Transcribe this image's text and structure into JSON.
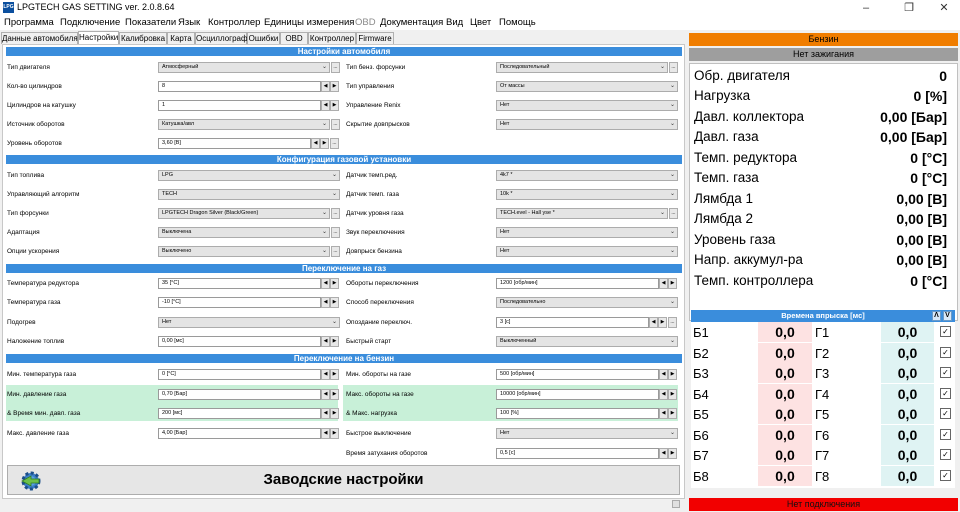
{
  "window": {
    "title": "LPGTECH GAS SETTING ver. 2.0.8.64",
    "icon_text": "LPG",
    "controls": [
      "minimize-icon",
      "restore-icon",
      "close-icon"
    ]
  },
  "menu": [
    "Программа",
    "Подключение",
    "Показатели",
    "Язык",
    "Контроллер",
    "Единицы измерения",
    "OBD",
    "Документация",
    "Вид",
    "Цвет",
    "Помощь"
  ],
  "tabs": [
    "Данные автомобиля",
    "Настройки",
    "Калибровка",
    "Карта",
    "Осциллограф",
    "Ошибки",
    "OBD",
    "Контроллер",
    "Firmware"
  ],
  "active_tab": 1,
  "sections": {
    "car": "Настройки автомобиля",
    "gas": "Конфигурация газовой установки",
    "to_gas": "Переключение на газ",
    "to_petrol": "Переключение на бензин"
  },
  "fields": {
    "engine_type": {
      "label": "Тип двигателя",
      "value": "Атмосферный"
    },
    "cylinders": {
      "label": "Кол-во цилиндров",
      "value": "8"
    },
    "cyl_per_coil": {
      "label": "Цилиндров на катушку",
      "value": "1"
    },
    "rpm_source": {
      "label": "Источник оборотов",
      "value": "Катушка/авл"
    },
    "rpm_level": {
      "label": "Уровень оборотов",
      "value": "3,60 [В]"
    },
    "petrol_inj_type": {
      "label": "Тип бенз. форсунки",
      "value": "Последовательный"
    },
    "control_type": {
      "label": "Тип управления",
      "value": "От массы"
    },
    "renix": {
      "label": "Управление Renix",
      "value": "Нет"
    },
    "hide_inj": {
      "label": "Скрытие довпрысков",
      "value": "Нет"
    },
    "fuel_type": {
      "label": "Тип топлива",
      "value": "LPG"
    },
    "algorithm": {
      "label": "Управляющий алгоритм",
      "value": "TECH"
    },
    "injector_type": {
      "label": "Тип форсунки",
      "value": "LPGTECH Dragon Silver (Black/Green)"
    },
    "adaptation": {
      "label": "Адаптация",
      "value": "Выключена"
    },
    "accel_option": {
      "label": "Опции ускорения",
      "value": "Выключено"
    },
    "reducer_sensor": {
      "label": "Датчик темп.ред.",
      "value": "4k7 *"
    },
    "gas_temp_sensor": {
      "label": "Датчик темп. газа",
      "value": "10k *"
    },
    "gas_level_sensor": {
      "label": "Датчик уровня газа",
      "value": "TECH.evel - Hall уse *"
    },
    "switch_sound": {
      "label": "Звук переключения",
      "value": "Нет"
    },
    "petrol_extra": {
      "label": "Довпрыск бензина",
      "value": "Нет"
    },
    "reducer_temp": {
      "label": "Температура редуктора",
      "value": "35 [°C]"
    },
    "gas_temp": {
      "label": "Температура газа",
      "value": "-10 [°C]"
    },
    "heating": {
      "label": "Подогрев",
      "value": "Нет"
    },
    "fuel_overlap": {
      "label": "Наложение топлив",
      "value": "0,00 [мс]"
    },
    "switch_rpm": {
      "label": "Обороты переключения",
      "value": "1200 [обр/мин]"
    },
    "switch_method": {
      "label": "Способ переключения",
      "value": "Последовательно"
    },
    "switch_delay": {
      "label": "Опоздание переключ.",
      "value": "3 [с]"
    },
    "quick_start": {
      "label": "Быстрый старт",
      "value": "Выключенный"
    },
    "min_gas_temp": {
      "label": "Мин. температура газа",
      "value": "0 [°C]"
    },
    "min_gas_press": {
      "label": "Мин. давление газа",
      "value": "0,70 [Бар]"
    },
    "min_press_time": {
      "label": "& Время мин. давл. газа",
      "value": "200 [мс]"
    },
    "max_gas_press": {
      "label": "Макс. давление газа",
      "value": "4,00 [Бар]"
    },
    "min_rpm_gas": {
      "label": "Мин. обороты на газе",
      "value": "500 [обр/мин]"
    },
    "max_rpm_gas": {
      "label": "Макс. обороты на газе",
      "value": "10000 [обр/мин]"
    },
    "max_load": {
      "label": "& Макс. нагрузка",
      "value": "100 [%]"
    },
    "quick_off": {
      "label": "Быстрое выключение",
      "value": "Нет"
    },
    "rpm_decay": {
      "label": "Время затухания оборотов",
      "value": "0,5 [с]"
    }
  },
  "factory_button": "Заводские настройки",
  "status": {
    "fuel": "Бензин",
    "ignition": "Нет зажигания",
    "connection": "Нет подключения",
    "fuel_color": "#f07d00",
    "ignition_color": "#9e9e9e",
    "connection_color": "#f20000"
  },
  "readings": [
    {
      "label": "Обр. двигателя",
      "value": "0"
    },
    {
      "label": "Нагрузка",
      "value": "0 [%]"
    },
    {
      "label": "Давл. коллектора",
      "value": "0,00 [Бар]"
    },
    {
      "label": "Давл. газа",
      "value": "0,00 [Бар]"
    },
    {
      "label": "Темп. редуктора",
      "value": "0 [°C]"
    },
    {
      "label": "Темп. газа",
      "value": "0 [°C]"
    },
    {
      "label": "Лямбда 1",
      "value": "0,00 [В]"
    },
    {
      "label": "Лямбда 2",
      "value": "0,00 [В]"
    },
    {
      "label": "Уровень газа",
      "value": "0,00 [В]"
    },
    {
      "label": "Напр. аккумул-ра",
      "value": "0,00 [В]"
    },
    {
      "label": "Темп. контроллера",
      "value": "0 [°C]"
    }
  ],
  "injection": {
    "title": "Времена впрыска [мс]",
    "rows": [
      {
        "b": "Б1",
        "bv": "0,0",
        "g": "Г1",
        "gv": "0,0"
      },
      {
        "b": "Б2",
        "bv": "0,0",
        "g": "Г2",
        "gv": "0,0"
      },
      {
        "b": "Б3",
        "bv": "0,0",
        "g": "Г3",
        "gv": "0,0"
      },
      {
        "b": "Б4",
        "bv": "0,0",
        "g": "Г4",
        "gv": "0,0"
      },
      {
        "b": "Б5",
        "bv": "0,0",
        "g": "Г5",
        "gv": "0,0"
      },
      {
        "b": "Б6",
        "bv": "0,0",
        "g": "Г6",
        "gv": "0,0"
      },
      {
        "b": "Б7",
        "bv": "0,0",
        "g": "Г7",
        "gv": "0,0"
      },
      {
        "b": "Б8",
        "bv": "0,0",
        "g": "Г8",
        "gv": "0,0"
      }
    ]
  },
  "accent": "#3a8ddc"
}
